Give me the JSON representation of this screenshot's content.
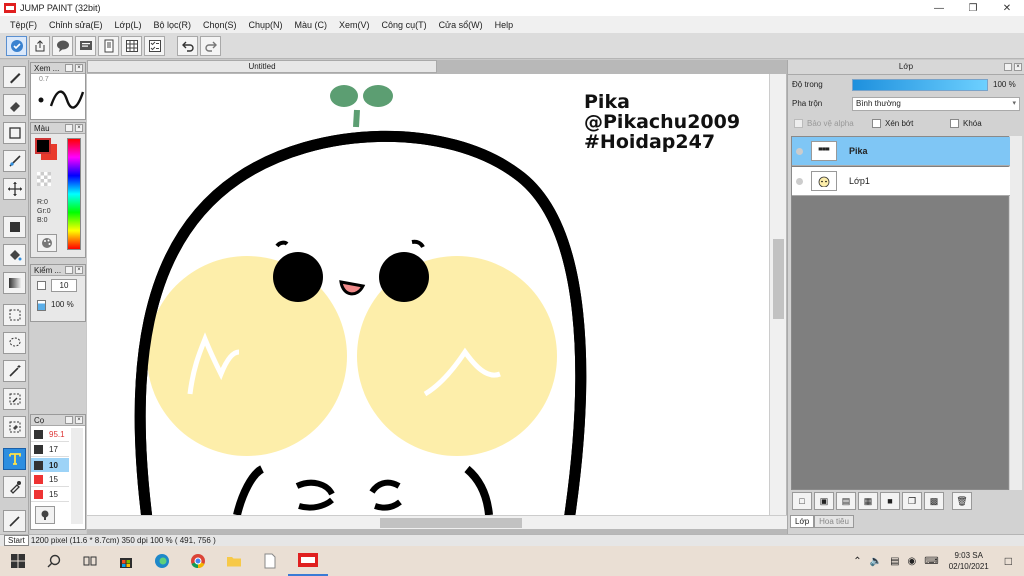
{
  "window": {
    "title": "JUMP PAINT (32bit)"
  },
  "menu": [
    "Tệp(F)",
    "Chỉnh sửa(E)",
    "Lớp(L)",
    "Bộ lọc(R)",
    "Chọn(S)",
    "Chụp(N)",
    "Màu (C)",
    "Xem(V)",
    "Công cụ(T)",
    "Cửa sổ(W)",
    "Help"
  ],
  "canvas": {
    "tab_title": "Untitled",
    "text_lines": [
      "Pika",
      "@Pikachu2009",
      "#Hoidap247"
    ]
  },
  "navigator_panel": {
    "label": "Xem ...",
    "zoom_fragment": "0.7"
  },
  "color_panel": {
    "label": "Màu",
    "r": "R:0",
    "g": "Gr:0",
    "b": "B:0"
  },
  "brush_size_panel": {
    "label": "Kiểm ...",
    "size": "10",
    "opacity": "100 %"
  },
  "size_panel": {
    "label": "Cọ",
    "sizes": [
      "95.1",
      "17",
      "10",
      "15",
      "15"
    ]
  },
  "layers": {
    "panel_title": "Lớp",
    "opacity_label": "Độ trong",
    "opacity_value": "100 %",
    "opacity_level": 1.0,
    "blend_label": "Pha trộn",
    "blend_value": "Bình thường",
    "protect_alpha": "Bảo vệ alpha",
    "clipping": "Xén bớt",
    "lock": "Khóa",
    "items": [
      {
        "name": "Pika",
        "selected": true
      },
      {
        "name": "Lớp1",
        "selected": false
      }
    ],
    "tabs": [
      "Lớp",
      "Hoa tiêu"
    ]
  },
  "status": {
    "start_tip": "Start",
    "size_text": "1200 pixel  (11.6 * 8.7cm)  350 dpi  100 %  ( 491, 756 )"
  },
  "taskbar": {
    "time": "9:03 SA",
    "date": "02/10/2021"
  },
  "colors": {
    "accent": "#2e8ee0",
    "selected_layer": "#7fc6f5",
    "blush": "#fdeeaa",
    "sprout": "#5c9e72"
  }
}
